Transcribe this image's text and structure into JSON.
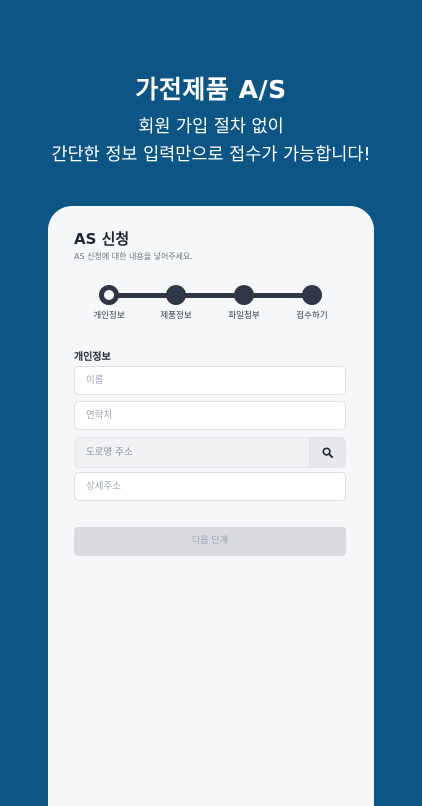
{
  "hero": {
    "title": "가전제품 A/S",
    "subtitle_line1": "회원 가입 절차 없이",
    "subtitle_line2": "간단한 정보 입력만으로 접수가 가능합니다!"
  },
  "form": {
    "title": "AS 신청",
    "description": "AS 신청에 대한 내용을 넣어주세요.",
    "steps": [
      {
        "label": "개인정보",
        "state": "active"
      },
      {
        "label": "제품정보",
        "state": "pending"
      },
      {
        "label": "파일첨부",
        "state": "pending"
      },
      {
        "label": "접수하기",
        "state": "pending"
      }
    ],
    "section_label": "개인정보",
    "fields": {
      "name_placeholder": "이름",
      "phone_placeholder": "연락처",
      "address_placeholder": "도로명 주소",
      "address_detail_placeholder": "상세주소"
    },
    "next_button": "다음 단계"
  },
  "colors": {
    "background": "#0d5585",
    "card": "#f6f7f9",
    "stepper": "#2f3747",
    "disabled_button": "#d8dadf"
  },
  "icons": {
    "address_search": "search-icon"
  }
}
